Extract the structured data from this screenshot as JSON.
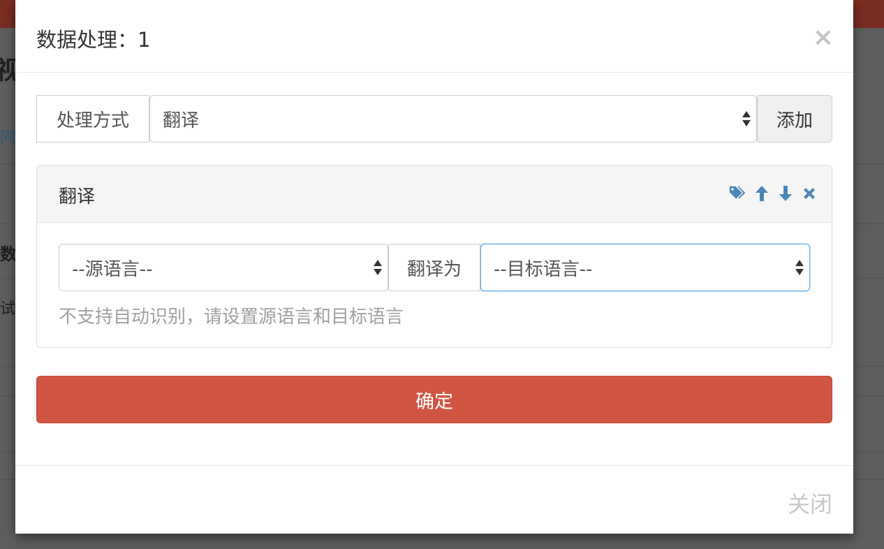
{
  "background": {
    "heading_fragment": "视贝",
    "link_fragment": "网",
    "bold_fragment": "数抓",
    "small_fragment": "试i"
  },
  "modal": {
    "title": "数据处理：1",
    "close_glyph": "×"
  },
  "method_row": {
    "label": "处理方式",
    "selected": "翻译",
    "add_button": "添加"
  },
  "panel": {
    "title": "翻译",
    "tools": [
      "tag-icon",
      "arrow-up-icon",
      "arrow-down-icon",
      "remove-icon"
    ],
    "source_select": "--源语言--",
    "middle_label": "翻译为",
    "target_select": "--目标语言--",
    "help_text": "不支持自动识别，请设置源语言和目标语言"
  },
  "actions": {
    "confirm": "确定",
    "close": "关闭"
  },
  "colors": {
    "confirm_bg": "#cf5542",
    "icon_blue": "#4a86b8",
    "focus_border": "#66afe9"
  }
}
